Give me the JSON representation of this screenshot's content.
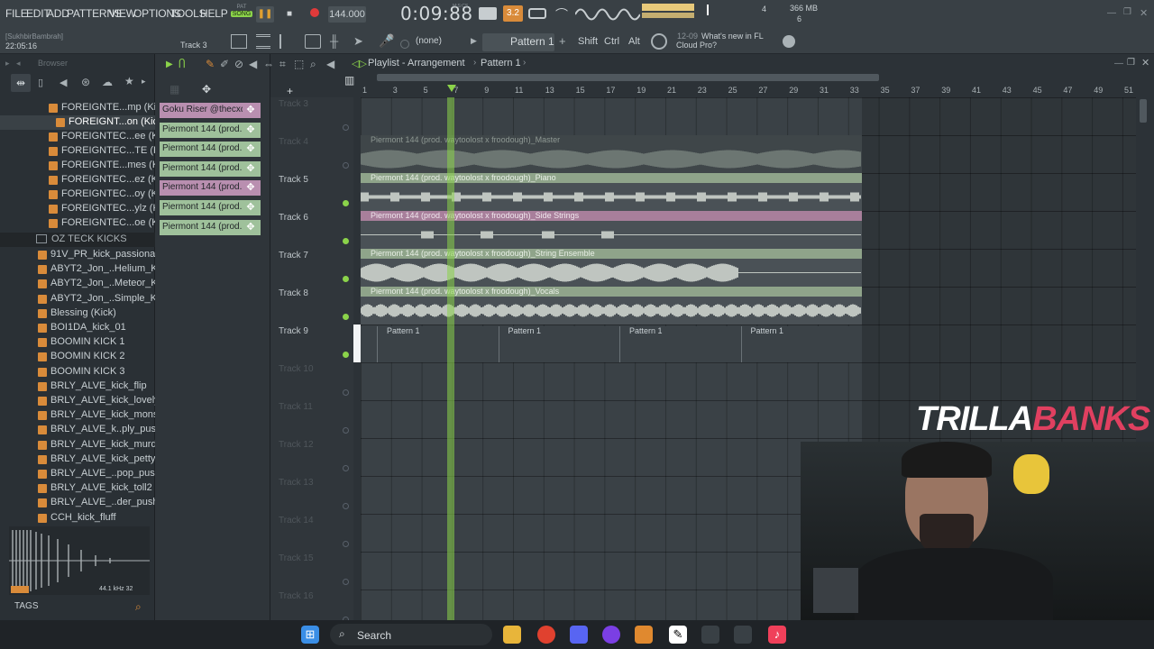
{
  "menu": [
    "FILE",
    "EDIT",
    "ADD",
    "PATTERNS",
    "VIEW",
    "OPTIONS",
    "TOOLS",
    "HELP"
  ],
  "transport": {
    "mode": "SONG",
    "mode_top": "PAT",
    "tempo": "144.000",
    "time": "0:09:88",
    "time_unit": "M:S:CS",
    "snap": "3.2",
    "cpu_label": "4",
    "mem": "366 MB",
    "mem2": "6"
  },
  "hint": {
    "user": "[SukhbirBambrah]",
    "clock": "22:05:16",
    "track": "Track 3"
  },
  "toolbar": {
    "none_label": "(none)",
    "pattern": "Pattern 1",
    "shift": "Shift",
    "ctrl": "Ctrl",
    "alt": "Alt",
    "news_date": "12-09",
    "news_text": "What's new in FL Cloud Pro?"
  },
  "browser": {
    "title": "Browser",
    "folder": "OZ TECK KICKS",
    "tags": "TAGS",
    "sample_info": "44.1 kHz 32",
    "items_top": [
      "FOREIGNTE...mp (Kick)",
      "FOREIGNT...on (Kick)",
      "FOREIGNTEC...ee (Kick)",
      "FOREIGNTEC...TE (Kick)",
      "FOREIGNTE...mes (Kick)",
      "FOREIGNTEC...ez (Kick)",
      "FOREIGNTEC...oy (Kick)",
      "FOREIGNTEC...ylz (Kick)",
      "FOREIGNTEC...oe (Kick)"
    ],
    "items": [
      "91V_PR_kick_passionate",
      "ABYT2_Jon_..Helium_Kick",
      "ABYT2_Jon_..Meteor_Kick",
      "ABYT2_Jon_..Simple_Kick",
      "Blessing (Kick)",
      "BOI1DA_kick_01",
      "BOOMIN KICK 1",
      "BOOMIN KICK 2",
      "BOOMIN KICK 3",
      "BRLY_ALVE_kick_flip",
      "BRLY_ALVE_kick_lovely",
      "BRLY_ALVE_kick_monster",
      "BRLY_ALVE_k..ply_pushed",
      "BRLY_ALVE_kick_murder",
      "BRLY_ALVE_kick_petty",
      "BRLY_ALVE_..pop_pushed",
      "BRLY_ALVE_kick_toll2",
      "BRLY_ALVE_..der_pushed",
      "CCH_kick_fluff"
    ]
  },
  "channels": [
    {
      "label": "Goku Riser @thecxdy",
      "color": "#b98fb0"
    },
    {
      "label": "Piermont 144 (prod...",
      "color": "#9fc19b"
    },
    {
      "label": "Piermont 144 (prod...",
      "color": "#9fc19b"
    },
    {
      "label": "Piermont 144 (prod...",
      "color": "#9fc19b"
    },
    {
      "label": "Piermont 144 (prod...",
      "color": "#b98fb0"
    },
    {
      "label": "Piermont 144 (prod...",
      "color": "#9fc19b"
    },
    {
      "label": "Piermont 144 (prod...",
      "color": "#9fc19b"
    }
  ],
  "playlist": {
    "title": "Playlist - Arrangement",
    "pattern": "Pattern 1",
    "ruler": [
      "1",
      "3",
      "5",
      "7",
      "9",
      "11",
      "13",
      "15",
      "17",
      "19",
      "21",
      "23",
      "25",
      "27",
      "29",
      "31",
      "33",
      "35",
      "37",
      "39",
      "41",
      "43",
      "45",
      "47",
      "49",
      "51"
    ],
    "tracks": [
      {
        "name": "Track 3",
        "active": false
      },
      {
        "name": "Track 4",
        "active": false
      },
      {
        "name": "Track 5",
        "active": true
      },
      {
        "name": "Track 6",
        "active": true
      },
      {
        "name": "Track 7",
        "active": true
      },
      {
        "name": "Track 8",
        "active": true
      },
      {
        "name": "Track 9",
        "active": true
      },
      {
        "name": "Track 10",
        "active": false
      },
      {
        "name": "Track 11",
        "active": false
      },
      {
        "name": "Track 12",
        "active": false
      },
      {
        "name": "Track 13",
        "active": false
      },
      {
        "name": "Track 14",
        "active": false
      },
      {
        "name": "Track 15",
        "active": false
      },
      {
        "name": "Track 16",
        "active": false
      }
    ],
    "clips": [
      {
        "label": "Piermont 144 (prod. waytoolost x froodough)_Master",
        "color": "#5f6a64",
        "text": "#8e9893"
      },
      {
        "label": "Piermont 144 (prod. waytoolost x froodough)_Piano",
        "color": "#8fa48a",
        "text": "#e8efe6"
      },
      {
        "label": "Piermont 144 (prod. waytoolost x froodough)_Side Strings",
        "color": "#a87f9b",
        "text": "#f0e6ed"
      },
      {
        "label": "Piermont 144 (prod. waytoolost x froodough)_String Ensemble",
        "color": "#8fa48a",
        "text": "#e8efe6"
      },
      {
        "label": "Piermont 144 (prod. waytoolost x froodough)_Vocals",
        "color": "#8fa48a",
        "text": "#e8efe6"
      }
    ],
    "pattern_clips": [
      "Pattern 1",
      "Pattern 1",
      "Pattern 1",
      "Pattern 1"
    ]
  },
  "watermark": {
    "a": "TRILLA",
    "b": "BANKS"
  },
  "taskbar": {
    "search": "Search"
  }
}
